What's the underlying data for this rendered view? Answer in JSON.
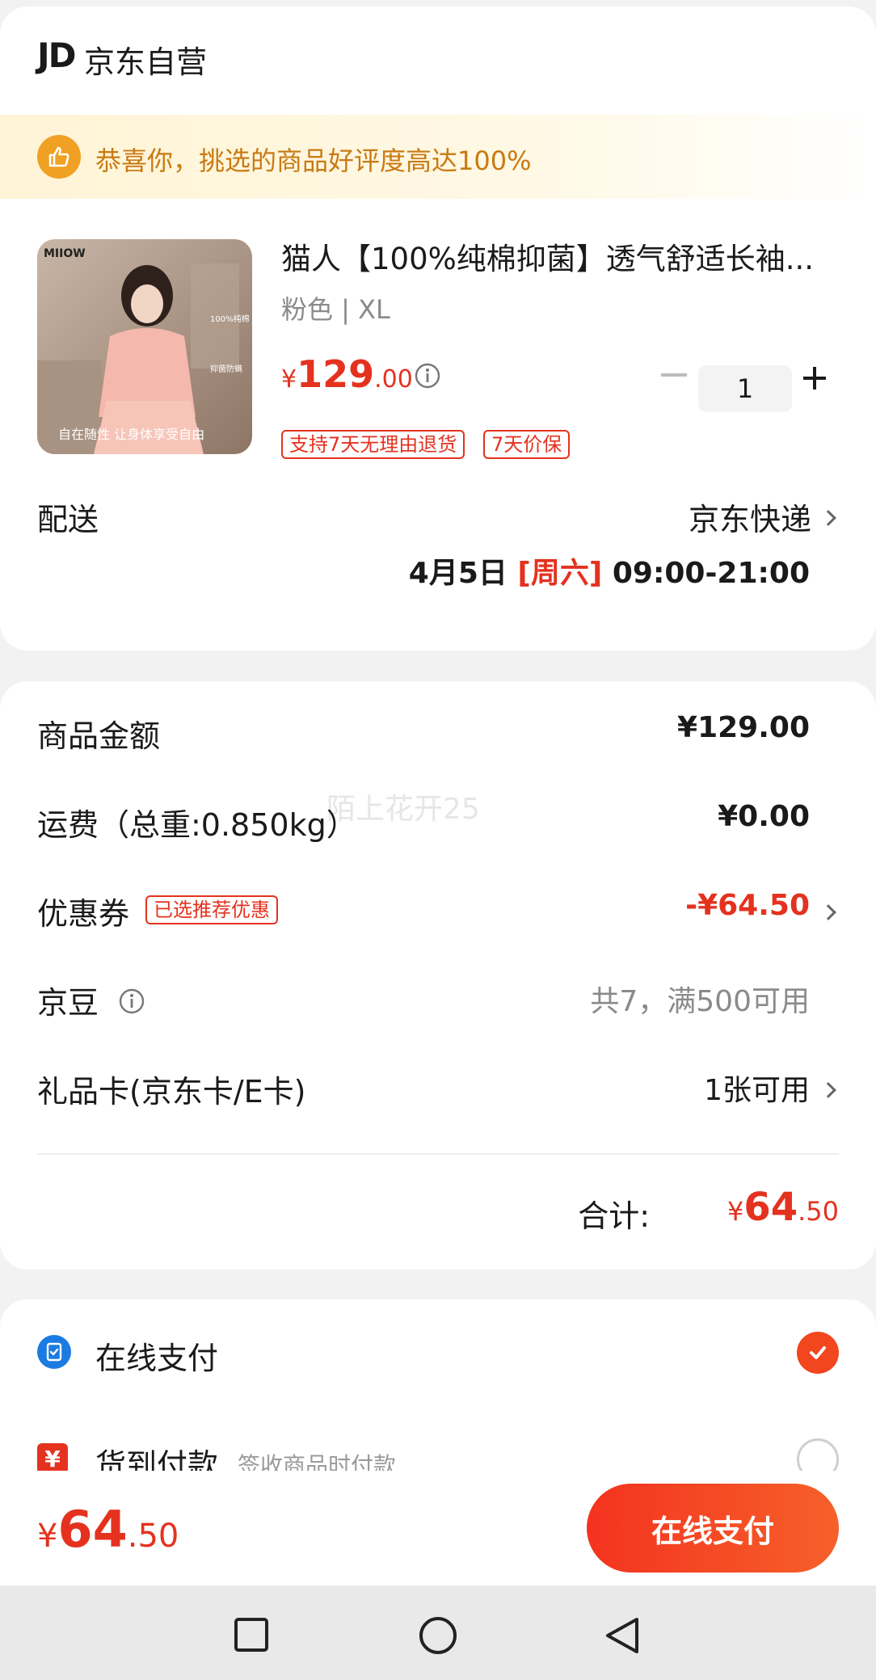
{
  "store": {
    "logo": "JD",
    "name": "京东自营",
    "praise": "恭喜你，挑选的商品好评度高达100%"
  },
  "product": {
    "title": "猫人【100%纯棉抑菌】透气舒适长袖...",
    "spec": "粉色 | XL",
    "price_currency": "¥",
    "price_int": "129",
    "price_dec": ".00",
    "quantity": "1",
    "tags": [
      "支持7天无理由退货",
      "7天价保"
    ],
    "image_brand": "MIIOW",
    "image_caption": "自在随性 让身体享受自由",
    "image_badge1": "100%纯棉",
    "image_badge2": "抑菌防螨"
  },
  "delivery": {
    "label": "配送",
    "method": "京东快递",
    "date": "4月5日 ",
    "weekday": "[周六]",
    "time": " 09:00-21:00"
  },
  "summary": {
    "goods_label": "商品金额",
    "goods_value": "¥129.00",
    "shipping_label": "运费（总重:0.850kg）",
    "shipping_value": "¥0.00",
    "coupon_label": "优惠券",
    "coupon_tag": "已选推荐优惠",
    "coupon_value": "-¥64.50",
    "beans_label": "京豆",
    "beans_value": "共7，满500可用",
    "giftcard_label": "礼品卡(京东卡/E卡)",
    "giftcard_value": "1张可用",
    "total_label": "合计:",
    "total_currency": "¥",
    "total_int": "64",
    "total_dec": ".50",
    "watermark": "陌上花开25"
  },
  "payment": {
    "online_label": "在线支付",
    "cod_label": "货到付款",
    "cod_sub": "签收商品时付款",
    "cod_icon": "¥",
    "selected": "online"
  },
  "bottom": {
    "currency": "¥",
    "int": "64",
    "dec": ".50",
    "pay_button": "在线支付"
  },
  "colors": {
    "accent_red": "#e4321f",
    "praise_orange": "#f0a023",
    "pay_blue": "#1b7be0"
  }
}
